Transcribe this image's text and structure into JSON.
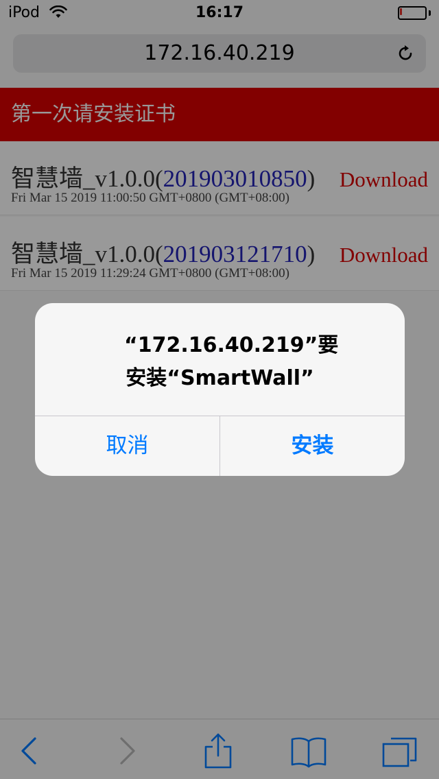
{
  "status_bar": {
    "carrier": "iPod",
    "time": "16:17",
    "battery_level": 0.1,
    "battery_color": "#e52d27"
  },
  "browser": {
    "url": "172.16.40.219",
    "reload_icon": "reload-icon"
  },
  "page": {
    "header_title": "第一次请安装证书",
    "header_color": "#d90000",
    "items": [
      {
        "name_prefix": "智慧墙_v1.0.0(",
        "build": "201903010850",
        "name_suffix": ")",
        "date": "Fri Mar 15 2019 11:00:50 GMT+0800 (GMT+08:00)",
        "download_label": "Download"
      },
      {
        "name_prefix": "智慧墙_v1.0.0(",
        "build": "201903121710",
        "name_suffix": ")",
        "date": "Fri Mar 15 2019 11:29:24 GMT+0800 (GMT+08:00)",
        "download_label": "Download"
      }
    ]
  },
  "alert": {
    "message": "“172.16.40.219”要安装“SmartWall”",
    "cancel_label": "取消",
    "install_label": "安装",
    "button_color": "#007aff"
  },
  "toolbar": {
    "icons": [
      "back-icon",
      "forward-icon",
      "share-icon",
      "bookmarks-icon",
      "tabs-icon"
    ]
  }
}
